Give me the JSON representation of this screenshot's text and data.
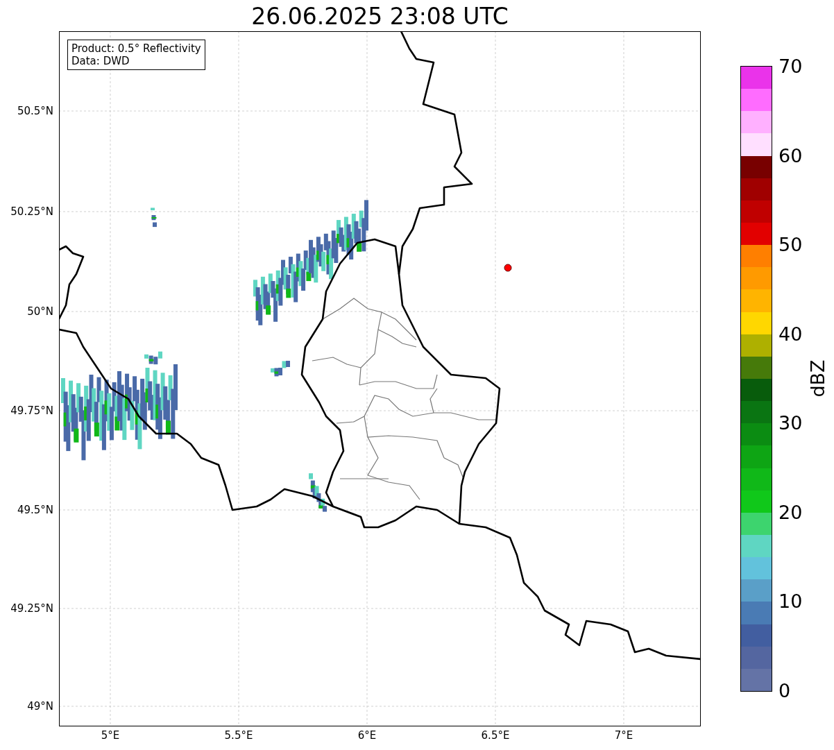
{
  "title": "26.06.2025 23:08 UTC",
  "legend": [
    "Product: 0.5° Reflectivity",
    "Data: DWD"
  ],
  "lat_labels": [
    "50.5°N",
    "50.25°N",
    "50°N",
    "49.75°N",
    "49.5°N",
    "49.25°N",
    "49°N"
  ],
  "lon_labels": [
    "5°E",
    "5.5°E",
    "6°E",
    "6.5°E",
    "7°E"
  ],
  "colorbar": {
    "label": "dBZ",
    "ticks": [
      "70",
      "60",
      "50",
      "40",
      "30",
      "20",
      "10",
      "0"
    ],
    "bands": [
      {
        "color": "#6473a6"
      },
      {
        "color": "#5466a0"
      },
      {
        "color": "#425ea0"
      },
      {
        "color": "#4a7bb4"
      },
      {
        "color": "#5a9fc8"
      },
      {
        "color": "#62c2dc"
      },
      {
        "color": "#5fd6c2"
      },
      {
        "color": "#3dd46e"
      },
      {
        "color": "#10c81a"
      },
      {
        "color": "#10b818"
      },
      {
        "color": "#0ea514"
      },
      {
        "color": "#0b8c12"
      },
      {
        "color": "#0a7512"
      },
      {
        "color": "#085c0c"
      },
      {
        "color": "#467a0a"
      },
      {
        "color": "#aeb000"
      },
      {
        "color": "#ffd700"
      },
      {
        "color": "#ffb400"
      },
      {
        "color": "#ff9a00"
      },
      {
        "color": "#ff7f00"
      },
      {
        "color": "#e20000"
      },
      {
        "color": "#c00000"
      },
      {
        "color": "#a00000"
      },
      {
        "color": "#780000"
      },
      {
        "color": "#ffdfff"
      },
      {
        "color": "#ffb0ff"
      },
      {
        "color": "#ff6cff"
      },
      {
        "color": "#ea33ea"
      }
    ]
  }
}
